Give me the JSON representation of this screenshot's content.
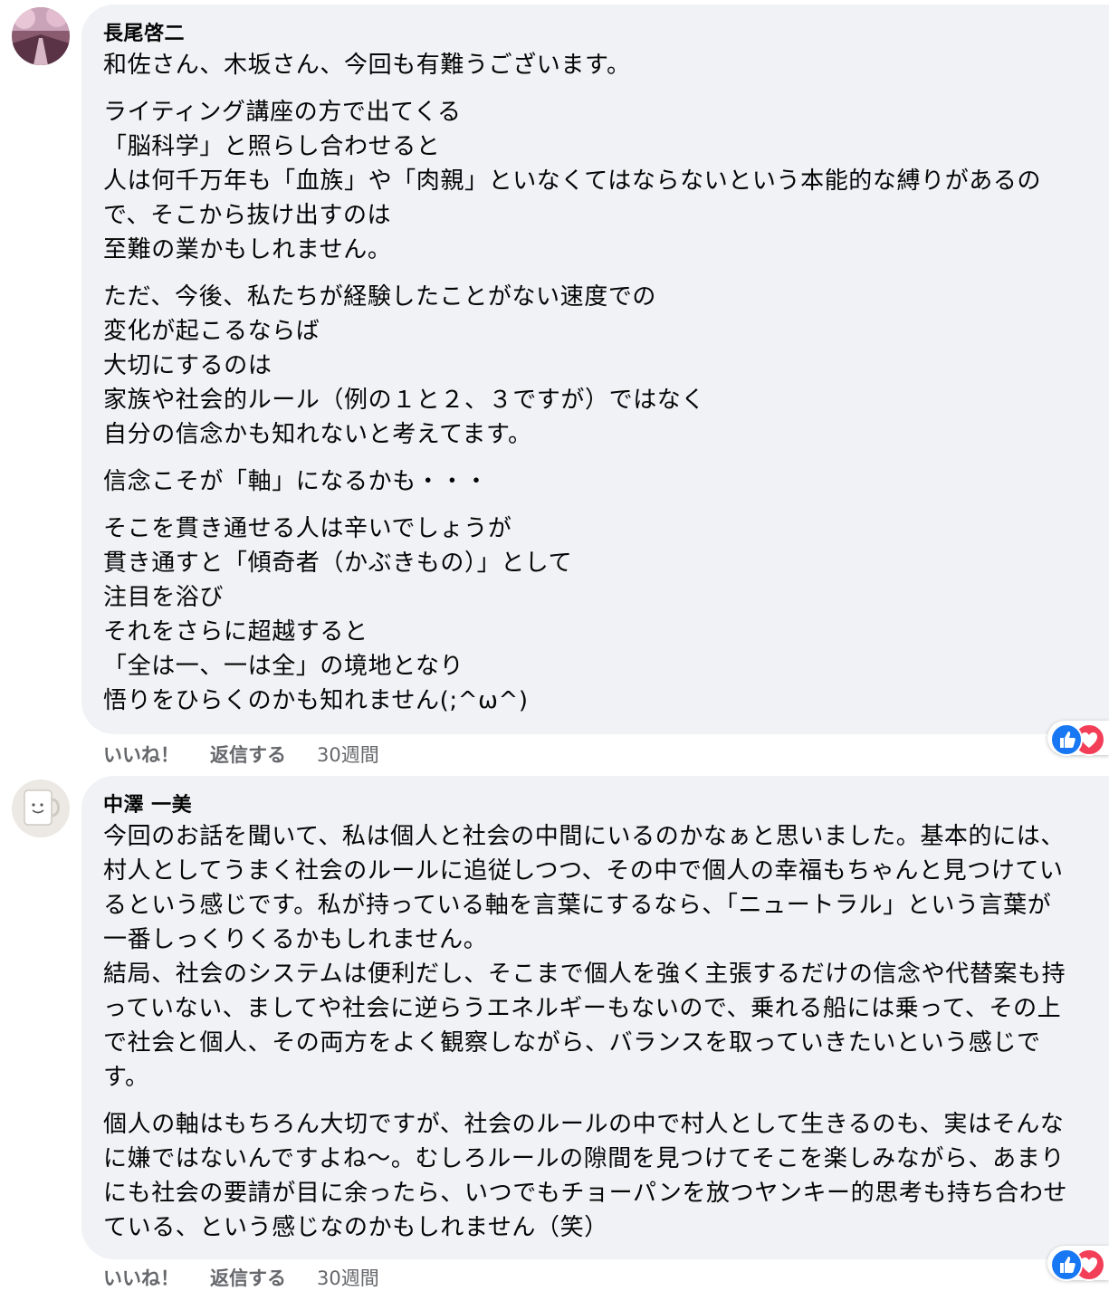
{
  "comments": [
    {
      "author": "長尾啓二",
      "paragraphs": [
        [
          "和佐さん、木坂さん、今回も有難うございます。"
        ],
        [
          "ライティング講座の方で出てくる",
          "「脳科学」と照らし合わせると",
          "人は何千万年も「血族」や「肉親」といなくてはならないという本能的な縛りがあるの",
          "で、そこから抜け出すのは",
          "至難の業かもしれません。"
        ],
        [
          "ただ、今後、私たちが経験したことがない速度での",
          "変化が起こるならば",
          "大切にするのは",
          "家族や社会的ルール（例の１と２、３ですが）ではなく",
          "自分の信念かも知れないと考えてます。"
        ],
        [
          "信念こそが「軸」になるかも・・・"
        ],
        [
          "そこを貫き通せる人は辛いでしょうが",
          "貫き通すと「傾奇者（かぶきもの）」として",
          "注目を浴び",
          "それをさらに超越すると",
          "「全は一、一は全」の境地となり",
          "悟りをひらくのかも知れません(;^ω^)"
        ]
      ],
      "actions": {
        "like": "いいね！",
        "reply": "返信する",
        "time": "30週間"
      },
      "reactions": [
        "like-icon",
        "love-icon"
      ]
    },
    {
      "author": "中澤 一美",
      "paragraphs": [
        [
          "今回のお話を聞いて、私は個人と社会の中間にいるのかなぁと思いました。基本的には、",
          "村人としてうまく社会のルールに追従しつつ、その中で個人の幸福もちゃんと見つけてい",
          "るという感じです。私が持っている軸を言葉にするなら、「ニュートラル」という言葉が",
          "一番しっくりくるかもしれません。",
          "結局、社会のシステムは便利だし、そこまで個人を強く主張するだけの信念や代替案も持",
          "っていない、ましてや社会に逆らうエネルギーもないので、乗れる船には乗って、その上",
          "で社会と個人、その両方をよく観察しながら、バランスを取っていきたいという感じで",
          "す。"
        ],
        [
          "個人の軸はもちろん大切ですが、社会のルールの中で村人として生きるのも、実はそんな",
          "に嫌ではないんですよね〜。むしろルールの隙間を見つけてそこを楽しみながら、あまり",
          "にも社会の要請が目に余ったら、いつでもチョーパンを放つヤンキー的思考も持ち合わせ",
          "ている、という感じなのかもしれません（笑）"
        ]
      ],
      "actions": {
        "like": "いいね！",
        "reply": "返信する",
        "time": "30週間"
      },
      "reactions": [
        "like-icon",
        "love-icon"
      ]
    }
  ],
  "colors": {
    "bubble": "#f0f2f5",
    "meta": "#65676b",
    "like": "#1877f2",
    "love": "#f33e58"
  }
}
